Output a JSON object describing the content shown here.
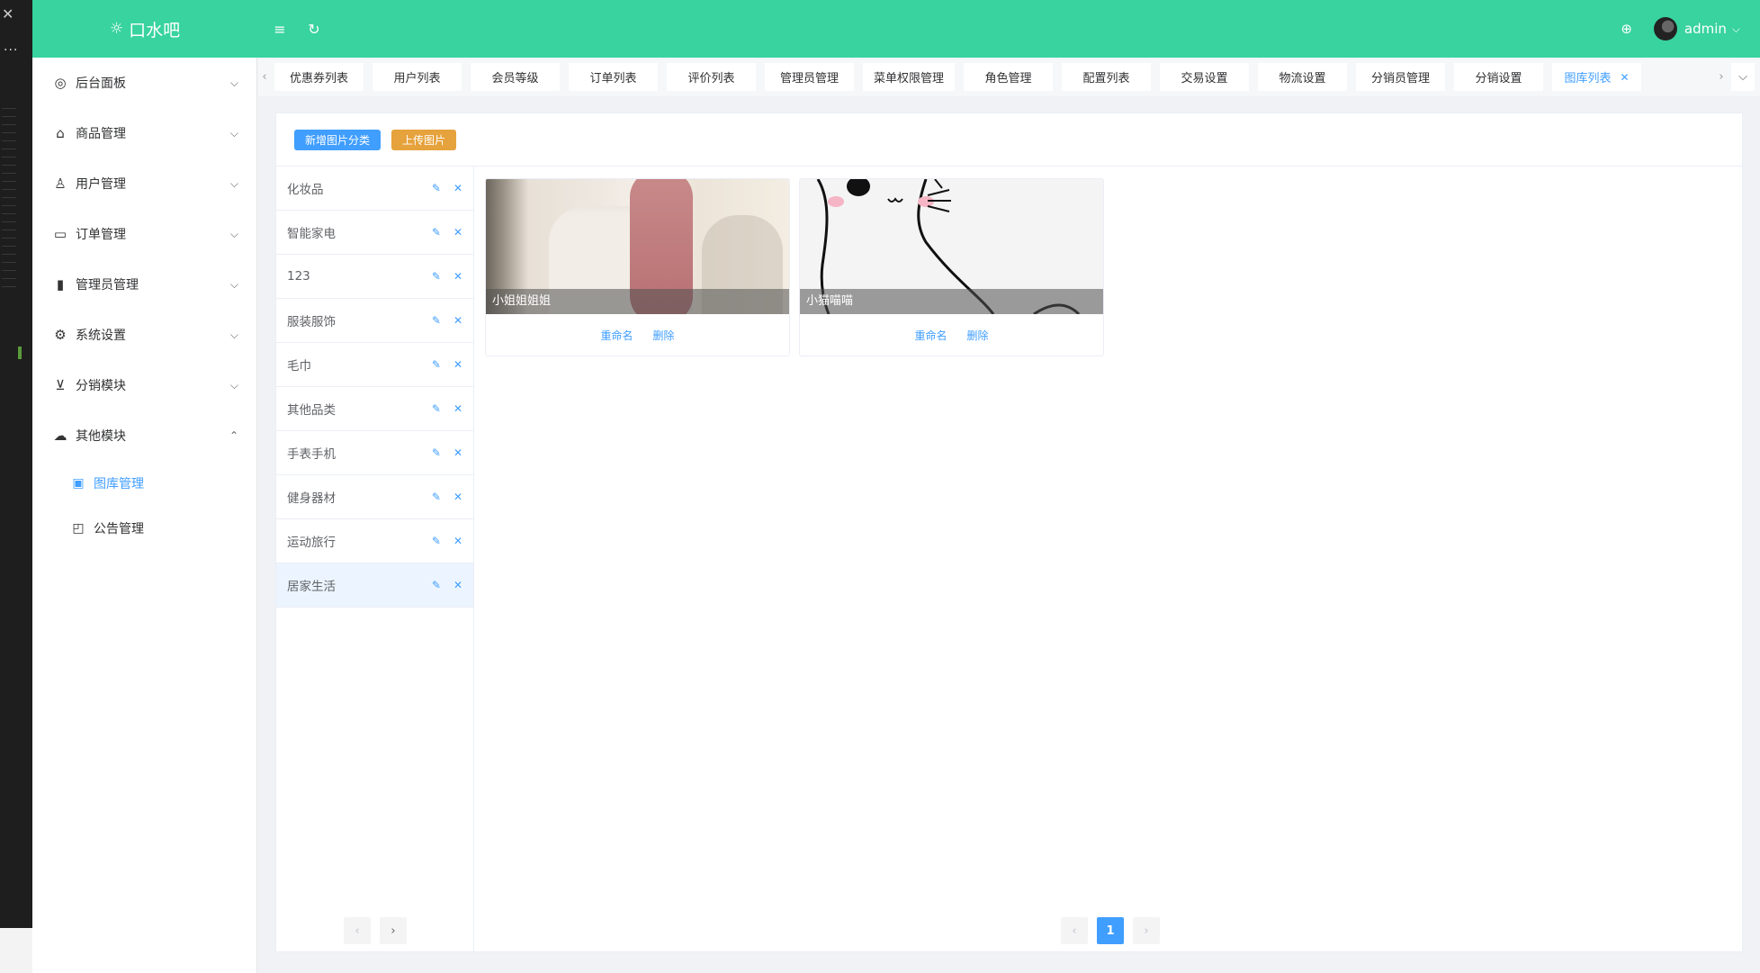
{
  "app": {
    "logo_icon": "sun-icon",
    "title": "口水吧"
  },
  "header": {
    "username": "admin",
    "icons": [
      "menu-fold-icon",
      "refresh-icon",
      "locate-icon",
      "avatar",
      "chevron-down-icon"
    ]
  },
  "sidebar": {
    "items": [
      {
        "label": "后台面板",
        "icon": "dashboard-icon"
      },
      {
        "label": "商品管理",
        "icon": "shopping-bag-icon"
      },
      {
        "label": "用户管理",
        "icon": "user-icon"
      },
      {
        "label": "订单管理",
        "icon": "order-box-icon"
      },
      {
        "label": "管理员管理",
        "icon": "admin-icon"
      },
      {
        "label": "系统设置",
        "icon": "gear-icon"
      },
      {
        "label": "分销模块",
        "icon": "cart-icon"
      },
      {
        "label": "其他模块",
        "icon": "cloud-icon"
      }
    ],
    "sub_items": [
      {
        "label": "图库管理",
        "icon": "picture-icon"
      },
      {
        "label": "公告管理",
        "icon": "notice-icon"
      }
    ]
  },
  "tabs": [
    "优惠券列表",
    "用户列表",
    "会员等级",
    "订单列表",
    "评价列表",
    "管理员管理",
    "菜单权限管理",
    "角色管理",
    "配置列表",
    "交易设置",
    "物流设置",
    "分销员管理",
    "分销设置",
    "图库列表"
  ],
  "toolbar": {
    "add_category": "新增图片分类",
    "upload": "上传图片"
  },
  "categories": [
    "化妆品",
    "智能家电",
    "123",
    "服装服饰",
    "毛巾",
    "其他品类",
    "手表手机",
    "健身器材",
    "运动旅行",
    "居家生活"
  ],
  "images": [
    {
      "name": "小姐姐姐姐",
      "rename": "重命名",
      "delete": "删除"
    },
    {
      "name": "小猫喵喵",
      "rename": "重命名",
      "delete": "删除"
    }
  ],
  "pagination": {
    "current": "1"
  },
  "colors": {
    "header": "#38d39f",
    "primary": "#409eff",
    "warning": "#e6a23c"
  }
}
